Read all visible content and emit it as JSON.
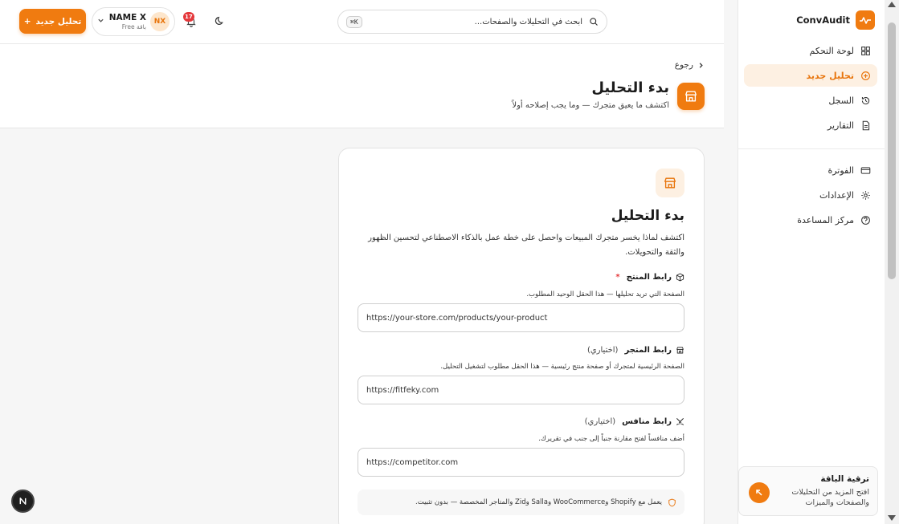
{
  "app": {
    "name": "ConvAudit",
    "accent": "#f07b10"
  },
  "sidebar": {
    "items": [
      {
        "label": "لوحة التحكم",
        "icon": "dashboard-icon",
        "active": false
      },
      {
        "label": "تحليل جديد",
        "icon": "plus-circle-icon",
        "active": true
      },
      {
        "label": "السجل",
        "icon": "history-icon",
        "active": false
      },
      {
        "label": "التقارير",
        "icon": "report-icon",
        "active": false
      },
      {
        "label": "الفوترة",
        "icon": "credit-card-icon",
        "active": false
      },
      {
        "label": "الإعدادات",
        "icon": "gear-icon",
        "active": false
      },
      {
        "label": "مركز المساعدة",
        "icon": "help-icon",
        "active": false
      }
    ],
    "upgrade": {
      "title": "ترقية الباقة",
      "description": "افتح المزيد من التحليلات والصفحات والميزات"
    }
  },
  "topbar": {
    "new_button": "تحليل جديد",
    "user": {
      "initials": "NX",
      "name": "NAME X",
      "plan": "باقة Free"
    },
    "notifications": "17",
    "search": {
      "placeholder": "ابحث في التحليلات والصفحات...",
      "shortcut": "⌘K"
    }
  },
  "page": {
    "back": "رجوع",
    "title": "بدء التحليل",
    "subtitle": "اكتشف ما يعيق متجرك — وما يجب إصلاحه أولاً"
  },
  "card": {
    "title": "بدء التحليل",
    "description": "اكتشف لماذا يخسر متجرك المبيعات واحصل على خطة عمل بالذكاء الاصطناعي لتحسين الظهور والثقة والتحويلات.",
    "fields": {
      "product": {
        "label": "رابط المنتج",
        "required_mark": "*",
        "hint": "الصفحة التي تريد تحليلها — هذا الحقل الوحيد المطلوب.",
        "placeholder": "https://your-store.com/products/your-product",
        "value": ""
      },
      "store": {
        "label": "رابط المتجر",
        "optional": "(اختياري)",
        "hint": "الصفحة الرئيسية لمتجرك أو صفحة منتج رئيسية — هذا الحقل مطلوب لتشغيل التحليل.",
        "placeholder": "",
        "value": "https://fitfeky.com"
      },
      "competitor": {
        "label": "رابط منافس",
        "optional": "(اختياري)",
        "hint": "أضف منافساً لفتح مقارنة جنباً إلى جنب في تقريرك.",
        "placeholder": "https://competitor.com",
        "value": ""
      }
    },
    "note": "يعمل مع Shopify وWooCommerce وSalla وZid والمتاجر المخصصة — بدون تثبيت."
  }
}
